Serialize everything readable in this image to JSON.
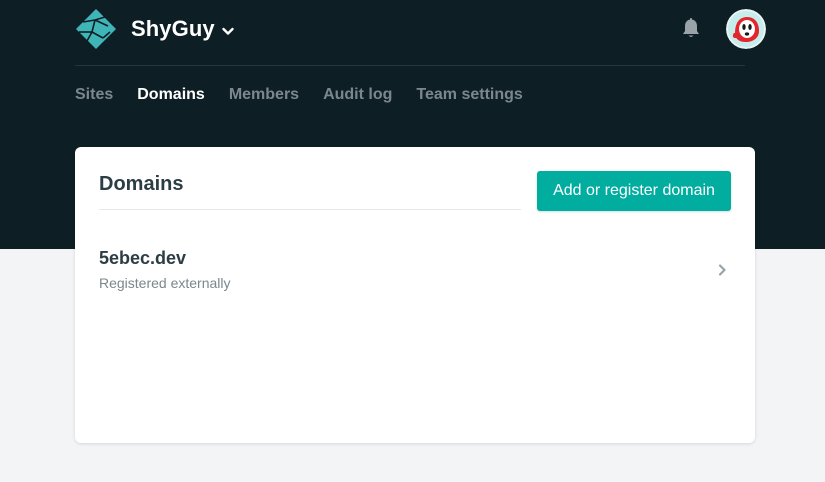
{
  "team": {
    "name": "ShyGuy"
  },
  "nav": {
    "items": [
      {
        "label": "Sites",
        "active": false
      },
      {
        "label": "Domains",
        "active": true
      },
      {
        "label": "Members",
        "active": false
      },
      {
        "label": "Audit log",
        "active": false
      },
      {
        "label": "Team settings",
        "active": false
      }
    ]
  },
  "icons": {
    "logo": "netlify-logo-icon",
    "team_dropdown": "chevron-down-icon",
    "notifications": "bell-icon",
    "user": "avatar",
    "row": "chevron-right-icon"
  },
  "domains": {
    "title": "Domains",
    "add_button_label": "Add or register domain",
    "list": [
      {
        "name": "5ebec.dev",
        "status": "Registered externally"
      }
    ]
  },
  "colors": {
    "header_bg": "#0e1e25",
    "page_bg": "#f2f4f6",
    "accent": "#00ad9f",
    "logo_teal": "#3fb5b8",
    "text_dark": "#2c3d45",
    "text_muted": "#7b878d"
  }
}
